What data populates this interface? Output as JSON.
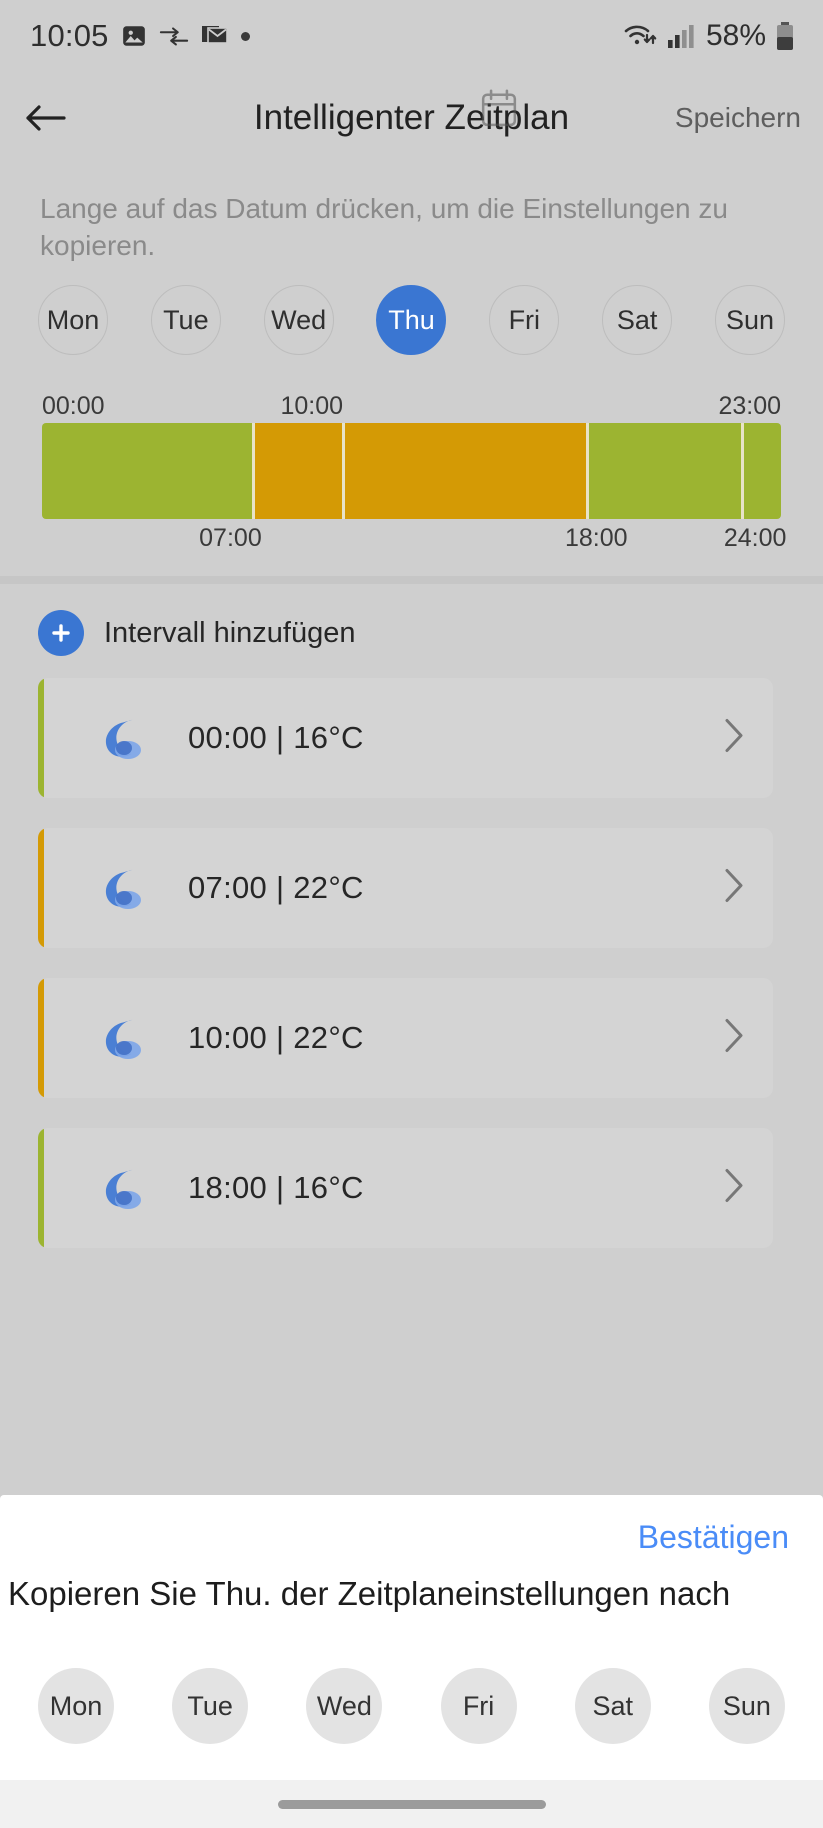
{
  "status_bar": {
    "time": "10:05",
    "left_icons": [
      "image-icon",
      "data-transfer-icon",
      "mail-icon",
      "dot-icon"
    ],
    "right_icons": [
      "wifi-icon",
      "cellular-signal-icon",
      "battery-icon"
    ],
    "battery_percent": "58%"
  },
  "app_bar": {
    "back_label": "back-arrow",
    "title": "Intelligenter Zeitplan",
    "save_label": "Speichern",
    "deco_icon": "calendar-icon"
  },
  "hint": {
    "text": "Lange auf das Datum drücken, um die Einstellungen zu kopieren."
  },
  "day_selector": {
    "days": [
      {
        "label": "Mon",
        "selected": false
      },
      {
        "label": "Tue",
        "selected": false
      },
      {
        "label": "Wed",
        "selected": false
      },
      {
        "label": "Thu",
        "selected": true
      },
      {
        "label": "Fri",
        "selected": false
      },
      {
        "label": "Sat",
        "selected": false
      },
      {
        "label": "Sun",
        "selected": false
      }
    ],
    "selected_day": "Thu",
    "selected_color": "#3a76d2"
  },
  "timeline": {
    "top_labels": [
      {
        "text": "00:00",
        "pos_pct": 0,
        "align": "left"
      },
      {
        "text": "10:00",
        "pos_pct": 36.5,
        "align": "center"
      },
      {
        "text": "23:00",
        "pos_pct": 100,
        "align": "right"
      }
    ],
    "bottom_labels": [
      {
        "text": "07:00",
        "pos_pct": 25.5,
        "align": "center"
      },
      {
        "text": "18:00",
        "pos_pct": 75.0,
        "align": "center"
      },
      {
        "text": "24:00",
        "pos_pct": 96.5,
        "align": "center"
      }
    ],
    "segments": [
      {
        "start": "00:00",
        "end": "07:00",
        "color": "#9cb431",
        "width_pct": 28.8
      },
      {
        "start": "07:00",
        "end": "10:00",
        "color": "#d49a05",
        "width_pct": 12.2
      },
      {
        "start": "10:00",
        "end": "18:00",
        "color": "#d49a05",
        "width_pct": 33.0
      },
      {
        "start": "18:00",
        "end": "23:00",
        "color": "#9cb431",
        "width_pct": 21.0
      },
      {
        "start": "23:00",
        "end": "24:00",
        "color": "#9cb431",
        "width_pct": 5.0
      }
    ],
    "divider_color": "#e8e3c8"
  },
  "add_interval": {
    "icon": "plus-icon",
    "label": "Intervall hinzufügen",
    "accent_color": "#3a76d2"
  },
  "intervals": [
    {
      "time": "00:00",
      "temperature": "16°C",
      "label": "00:00 | 16°C",
      "accent": "#9cb431",
      "icon": "night-moon-icon"
    },
    {
      "time": "07:00",
      "temperature": "22°C",
      "label": "07:00 | 22°C",
      "accent": "#d49a05",
      "icon": "night-moon-icon"
    },
    {
      "time": "10:00",
      "temperature": "22°C",
      "label": "10:00 | 22°C",
      "accent": "#d49a05",
      "icon": "night-moon-icon"
    },
    {
      "time": "18:00",
      "temperature": "16°C",
      "label": "18:00 | 16°C",
      "accent": "#9cb431",
      "icon": "night-moon-icon"
    }
  ],
  "bottom_sheet": {
    "confirm_label": "Bestätigen",
    "title": "Kopieren Sie Thu. der Zeitplaneinstellungen nach",
    "days": [
      {
        "label": "Mon"
      },
      {
        "label": "Tue"
      },
      {
        "label": "Wed"
      },
      {
        "label": "Fri"
      },
      {
        "label": "Sat"
      },
      {
        "label": "Sun"
      }
    ],
    "confirm_color": "#4a8cf7"
  },
  "nav_bar": {
    "handle": "home-gesture-pill"
  },
  "colors": {
    "background": "#cfcfcf",
    "card": "#d4d4d4",
    "accent_blue": "#3a76d2",
    "green": "#9cb431",
    "orange": "#d49a05",
    "sheet_bg": "#ffffff"
  }
}
